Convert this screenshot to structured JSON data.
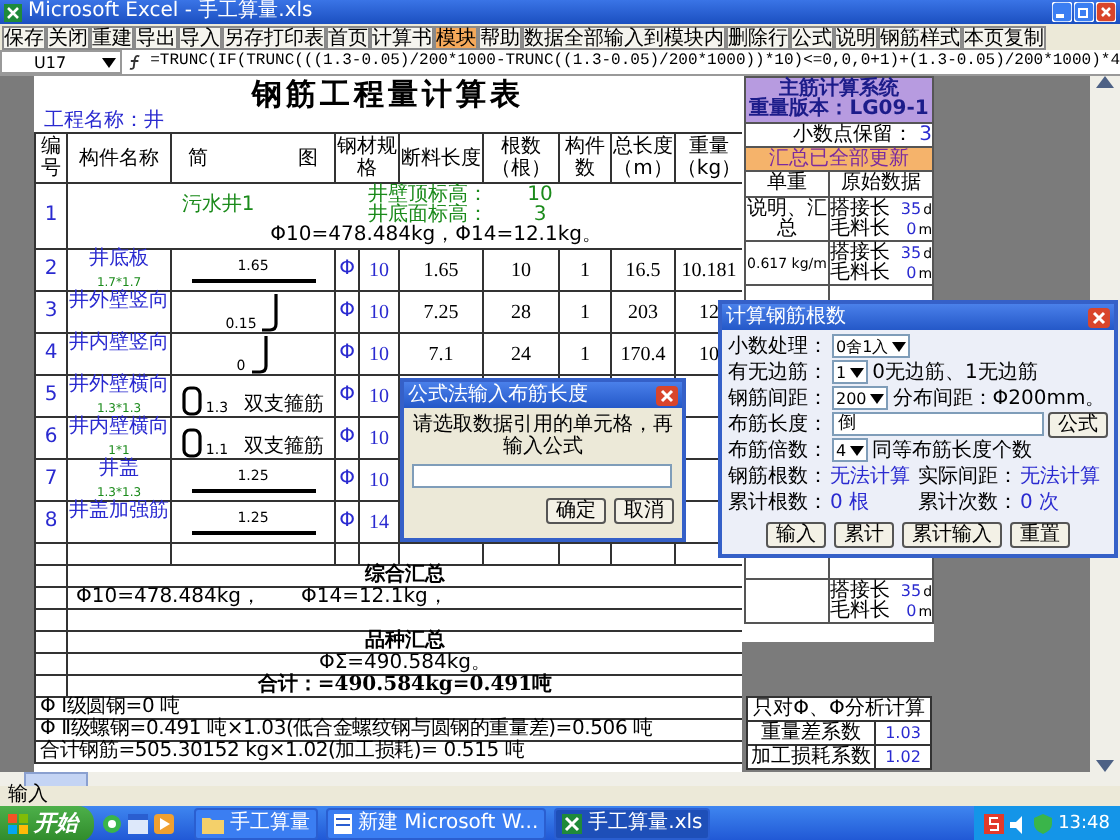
{
  "window": {
    "title": "Microsoft Excel - 手工算量.xls"
  },
  "toolbar": [
    {
      "label": "保存",
      "selected": false
    },
    {
      "label": "关闭",
      "selected": false
    },
    {
      "label": "重建",
      "selected": false
    },
    {
      "label": "导出",
      "selected": false
    },
    {
      "label": "导入",
      "selected": false
    },
    {
      "label": "另存打印表",
      "selected": false
    },
    {
      "label": "首页",
      "selected": false
    },
    {
      "label": "计算书",
      "selected": false
    },
    {
      "label": "模块",
      "selected": true
    },
    {
      "label": "帮助",
      "selected": false
    },
    {
      "label": "数据全部输入到模块内",
      "selected": false
    },
    {
      "label": "删除行",
      "selected": false
    },
    {
      "label": "公式",
      "selected": false
    },
    {
      "label": "说明",
      "selected": false
    },
    {
      "label": "钢筋样式",
      "selected": false
    },
    {
      "label": "本页复制",
      "selected": false
    }
  ],
  "formula_bar": {
    "cell": "U17",
    "formula": "=TRUNC(IF(TRUNC(((1.3-0.05)/200*1000-TRUNC((1.3-0.05)/200*1000))*10)<=0,0,0+1)+(1.3-0.05)/200*1000)*4"
  },
  "sheet": {
    "title": "钢筋工程量计算表",
    "project": "工程名称：井",
    "columns": [
      {
        "kind": "text",
        "label": "编号"
      },
      {
        "kind": "text",
        "label": "构件名称"
      },
      {
        "kind": "split",
        "left": "简",
        "right": "图"
      },
      {
        "kind": "wide",
        "label": "钢材规格"
      },
      {
        "kind": "text",
        "label": "断料长度"
      },
      {
        "kind": "text",
        "label": "根数（根）"
      },
      {
        "kind": "text",
        "label": "构件数"
      },
      {
        "kind": "text",
        "label": "总长度（m）"
      },
      {
        "kind": "text",
        "label": "重量（kg）"
      }
    ],
    "first_row": {
      "number": "1",
      "name": "污水井1",
      "levels": [
        {
          "label": "井壁顶标高：",
          "value": "10"
        },
        {
          "label": "井底面标高：",
          "value": "3"
        }
      ],
      "summary": "Φ10=478.484kg，Φ14=12.1kg。"
    },
    "rows": [
      {
        "number": "2",
        "name": "井底板",
        "size": "1.7*1.7",
        "sketch": {
          "kind": "bar",
          "label": "1.65"
        },
        "grade": "Φ",
        "diameter": "10",
        "length": "1.65",
        "count": "10",
        "members": "1",
        "total": "16.5",
        "weight": "10.181"
      },
      {
        "number": "3",
        "name": "井外壁竖向",
        "sketch": {
          "kind": "hook",
          "label": "0.15"
        },
        "grade": "Φ",
        "diameter": "10",
        "length": "7.25",
        "count": "28",
        "members": "1",
        "total": "203",
        "weight": "12"
      },
      {
        "number": "4",
        "name": "井内壁竖向",
        "sketch": {
          "kind": "hook",
          "label": "0"
        },
        "grade": "Φ",
        "diameter": "10",
        "length": "7.1",
        "count": "24",
        "members": "1",
        "total": "170.4",
        "weight": "10"
      },
      {
        "number": "5",
        "name": "井外壁横向",
        "size": "1.3*1.3",
        "sketch": {
          "kind": "stirrup",
          "label": "1.3",
          "note": "双支箍筋"
        },
        "grade": "Φ",
        "diameter": "10"
      },
      {
        "number": "6",
        "name": "井内壁横向",
        "size": "1*1",
        "sketch": {
          "kind": "stirrup",
          "label": "1.1",
          "note": "双支箍筋"
        },
        "grade": "Φ",
        "diameter": "10"
      },
      {
        "number": "7",
        "name": "井盖",
        "size": "1.3*1.3",
        "sketch": {
          "kind": "bar",
          "label": "1.25"
        },
        "grade": "Φ",
        "diameter": "10"
      },
      {
        "number": "8",
        "name": "井盖加强筋",
        "sketch": {
          "kind": "bar",
          "label": "1.25"
        },
        "grade": "Φ",
        "diameter": "14"
      }
    ],
    "summary": {
      "title": "综合汇总",
      "items": [
        "Φ10=478.484kg，",
        "Φ14=12.1kg，"
      ],
      "variety_title": "品种汇总",
      "variety_total": "ΦΣ=490.584kg。",
      "total": "合计：=490.584kg=0.491吨",
      "lines": [
        "Φ Ⅰ级圆钢=0 吨",
        "Φ Ⅱ级螺钢=0.491 吨×1.03(低合金螺纹钢与圆钢的重量差)=0.506 吨",
        "合计钢筋=505.30152 kg×1.02(加工损耗)= 0.515 吨"
      ]
    }
  },
  "panel": {
    "header": [
      "主筋计算系统",
      "重量版本：LG09-1"
    ],
    "decimals_label": "小数点保留：",
    "decimals": "3",
    "status": "汇总已全部更新",
    "columns": [
      "单重",
      "原始数据"
    ],
    "rows": [
      {
        "unit": "说明、汇总",
        "lap_label": "搭接长",
        "lap": "35",
        "lap_unit": "d",
        "raw_label": "毛料长",
        "raw": "0",
        "raw_unit": "m"
      },
      {
        "unit": "0.617 kg/m",
        "lap_label": "搭接长",
        "lap": "35",
        "lap_unit": "d",
        "raw_label": "毛料长",
        "raw": "0",
        "raw_unit": "m"
      },
      {
        "lap_label": "搭接长",
        "lap": "35",
        "lap_unit": "d",
        "raw_label": "毛料长",
        "raw": "0",
        "raw_unit": "m"
      }
    ],
    "factors": {
      "title": "只对Φ、Φ分析计算",
      "rows": [
        {
          "label": "重量差系数",
          "value": "1.03"
        },
        {
          "label": "加工损耗系数",
          "value": "1.02"
        }
      ]
    }
  },
  "count_dialog": {
    "title": "计算钢筋根数",
    "fields": [
      {
        "kind": "select",
        "label": "小数处理：",
        "value": "0舍1入"
      },
      {
        "kind": "select",
        "label": "有无边筋：",
        "value": "1",
        "note": "0无边筋、1无边筋"
      },
      {
        "kind": "select",
        "label": "钢筋间距：",
        "value": "200",
        "note": "分布间距：Φ200mm。"
      },
      {
        "kind": "input",
        "label": "布筋长度：",
        "value": "倒",
        "button": "公式"
      },
      {
        "kind": "select",
        "label": "布筋倍数：",
        "value": "4",
        "note": "同等布筋长度个数"
      },
      {
        "kind": "readout",
        "label": "钢筋根数：",
        "value": "无法计算",
        "label2": "实际间距：",
        "value2": "无法计算"
      },
      {
        "kind": "readout",
        "label": "累计根数：",
        "value": "0 根",
        "label2": "累计次数：",
        "value2": "0 次"
      }
    ],
    "buttons": [
      "输入",
      "累计",
      "累计输入",
      "重置"
    ]
  },
  "formula_dialog": {
    "title": "公式法输入布筋长度",
    "message": "请选取数据引用的单元格，再输入公式",
    "buttons": [
      "确定",
      "取消"
    ]
  },
  "status_bar": "输入",
  "taskbar": {
    "start": "开始",
    "tasks": [
      {
        "label": "手工算量",
        "kind": "folder",
        "selected": false
      },
      {
        "label": "新建 Microsoft W...",
        "kind": "document",
        "selected": false
      },
      {
        "label": "手工算量.xls",
        "kind": "spreadsheet",
        "selected": true
      }
    ],
    "clock": "13:48"
  }
}
